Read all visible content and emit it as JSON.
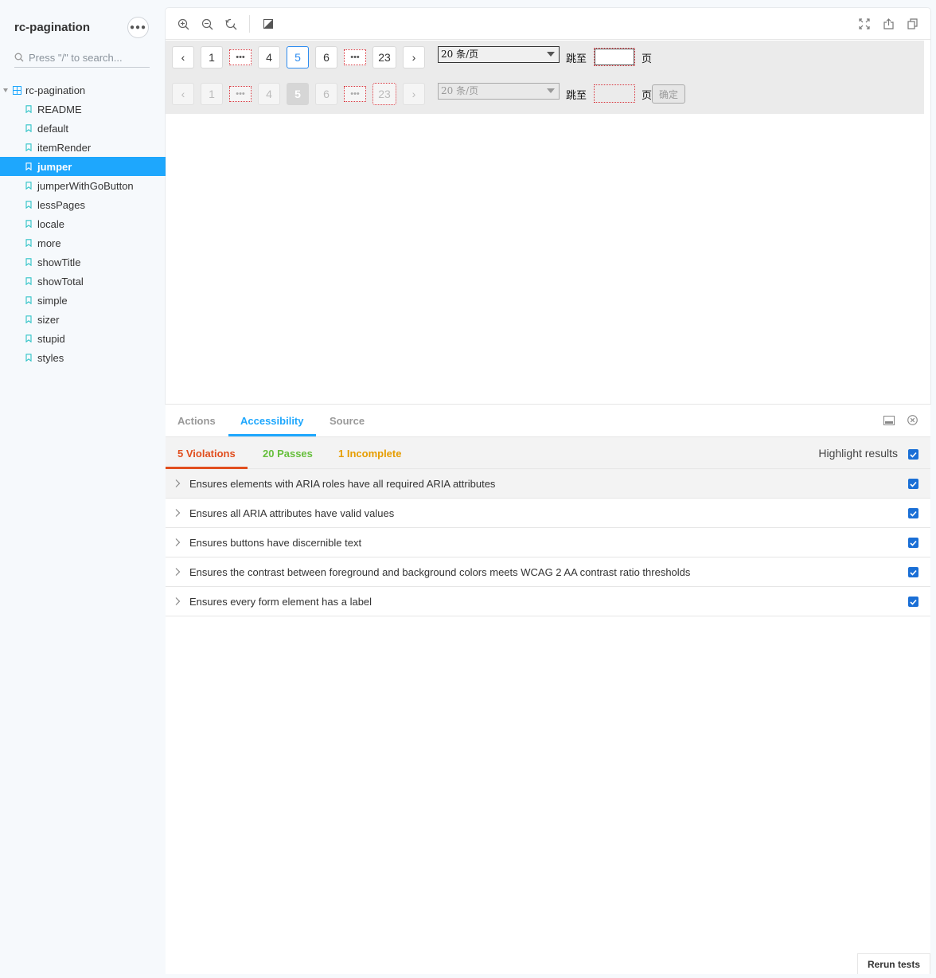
{
  "sidebar": {
    "brand": "rc-pagination",
    "search_placeholder": "Press \"/\" to search...",
    "root_label": "rc-pagination",
    "items": [
      {
        "label": "README"
      },
      {
        "label": "default"
      },
      {
        "label": "itemRender"
      },
      {
        "label": "jumper",
        "active": true
      },
      {
        "label": "jumperWithGoButton"
      },
      {
        "label": "lessPages"
      },
      {
        "label": "locale"
      },
      {
        "label": "more"
      },
      {
        "label": "showTitle"
      },
      {
        "label": "showTotal"
      },
      {
        "label": "simple"
      },
      {
        "label": "sizer"
      },
      {
        "label": "stupid"
      },
      {
        "label": "styles"
      }
    ]
  },
  "toolbar": {
    "icons": [
      "zoom-in-icon",
      "zoom-out-icon",
      "reset-zoom-icon",
      "background-icon",
      "fullscreen-icon",
      "share-icon",
      "copy-icon"
    ]
  },
  "pagination": {
    "prev": "‹",
    "next": "›",
    "pages": [
      "1",
      "•••",
      "4",
      "5",
      "6",
      "•••",
      "23"
    ],
    "current": "5",
    "size_option": "20 条/页",
    "jump_label": "跳至",
    "page_label": "页",
    "go_button": "确定"
  },
  "addons": {
    "tabs": [
      "Actions",
      "Accessibility",
      "Source"
    ],
    "active_tab": "Accessibility",
    "violations": "5 Violations",
    "passes": "20 Passes",
    "incomplete": "1 Incomplete",
    "highlight_label": "Highlight results",
    "rules": [
      "Ensures elements with ARIA roles have all required ARIA attributes",
      "Ensures all ARIA attributes have valid values",
      "Ensures buttons have discernible text",
      "Ensures the contrast between foreground and background colors meets WCAG 2 AA contrast ratio thresholds",
      "Ensures every form element has a label"
    ],
    "rerun": "Rerun tests"
  },
  "colors": {
    "accent": "#1ea7fd",
    "violation": "#e14e1e",
    "pass": "#66bf3c",
    "incomplete": "#e69d00",
    "checkbox": "#1a6fd6"
  }
}
